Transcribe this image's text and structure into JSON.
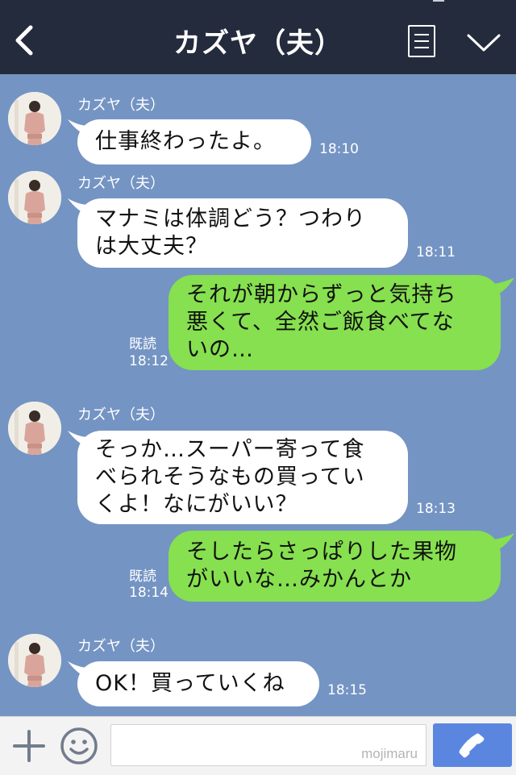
{
  "header": {
    "title": "カズヤ（夫）"
  },
  "messages": [
    {
      "sender": "カズヤ（夫）",
      "text": "仕事終わったよ。",
      "time": "18:10"
    },
    {
      "sender": "カズヤ（夫）",
      "text": "マナミは体調どう？つわり\nは大丈夫？",
      "time": "18:11"
    },
    {
      "read": "既読",
      "text": "それが朝からずっと気持ち\n悪くて、全然ご飯食べてな\nいの…",
      "time": "18:12"
    },
    {
      "sender": "カズヤ（夫）",
      "text": "そっか…スーパー寄って食\nべられそうなもの買ってい\nくよ！なにがいい？",
      "time": "18:13"
    },
    {
      "read": "既読",
      "text": "そしたらさっぱりした果物\nがいいな…みかんとか",
      "time": "18:14"
    },
    {
      "sender": "カズヤ（夫）",
      "text": "OK！買っていくね",
      "time": "18:15"
    }
  ],
  "input": {
    "watermark": "mojimaru"
  },
  "colors": {
    "background": "#7494c3",
    "header": "#242b3c",
    "incoming": "#ffffff",
    "outgoing": "#86e04f",
    "call": "#5b86e0"
  },
  "icons": [
    "back-icon",
    "menu-icon",
    "chevron-down-icon",
    "plus-icon",
    "smile-icon",
    "phone-icon"
  ]
}
